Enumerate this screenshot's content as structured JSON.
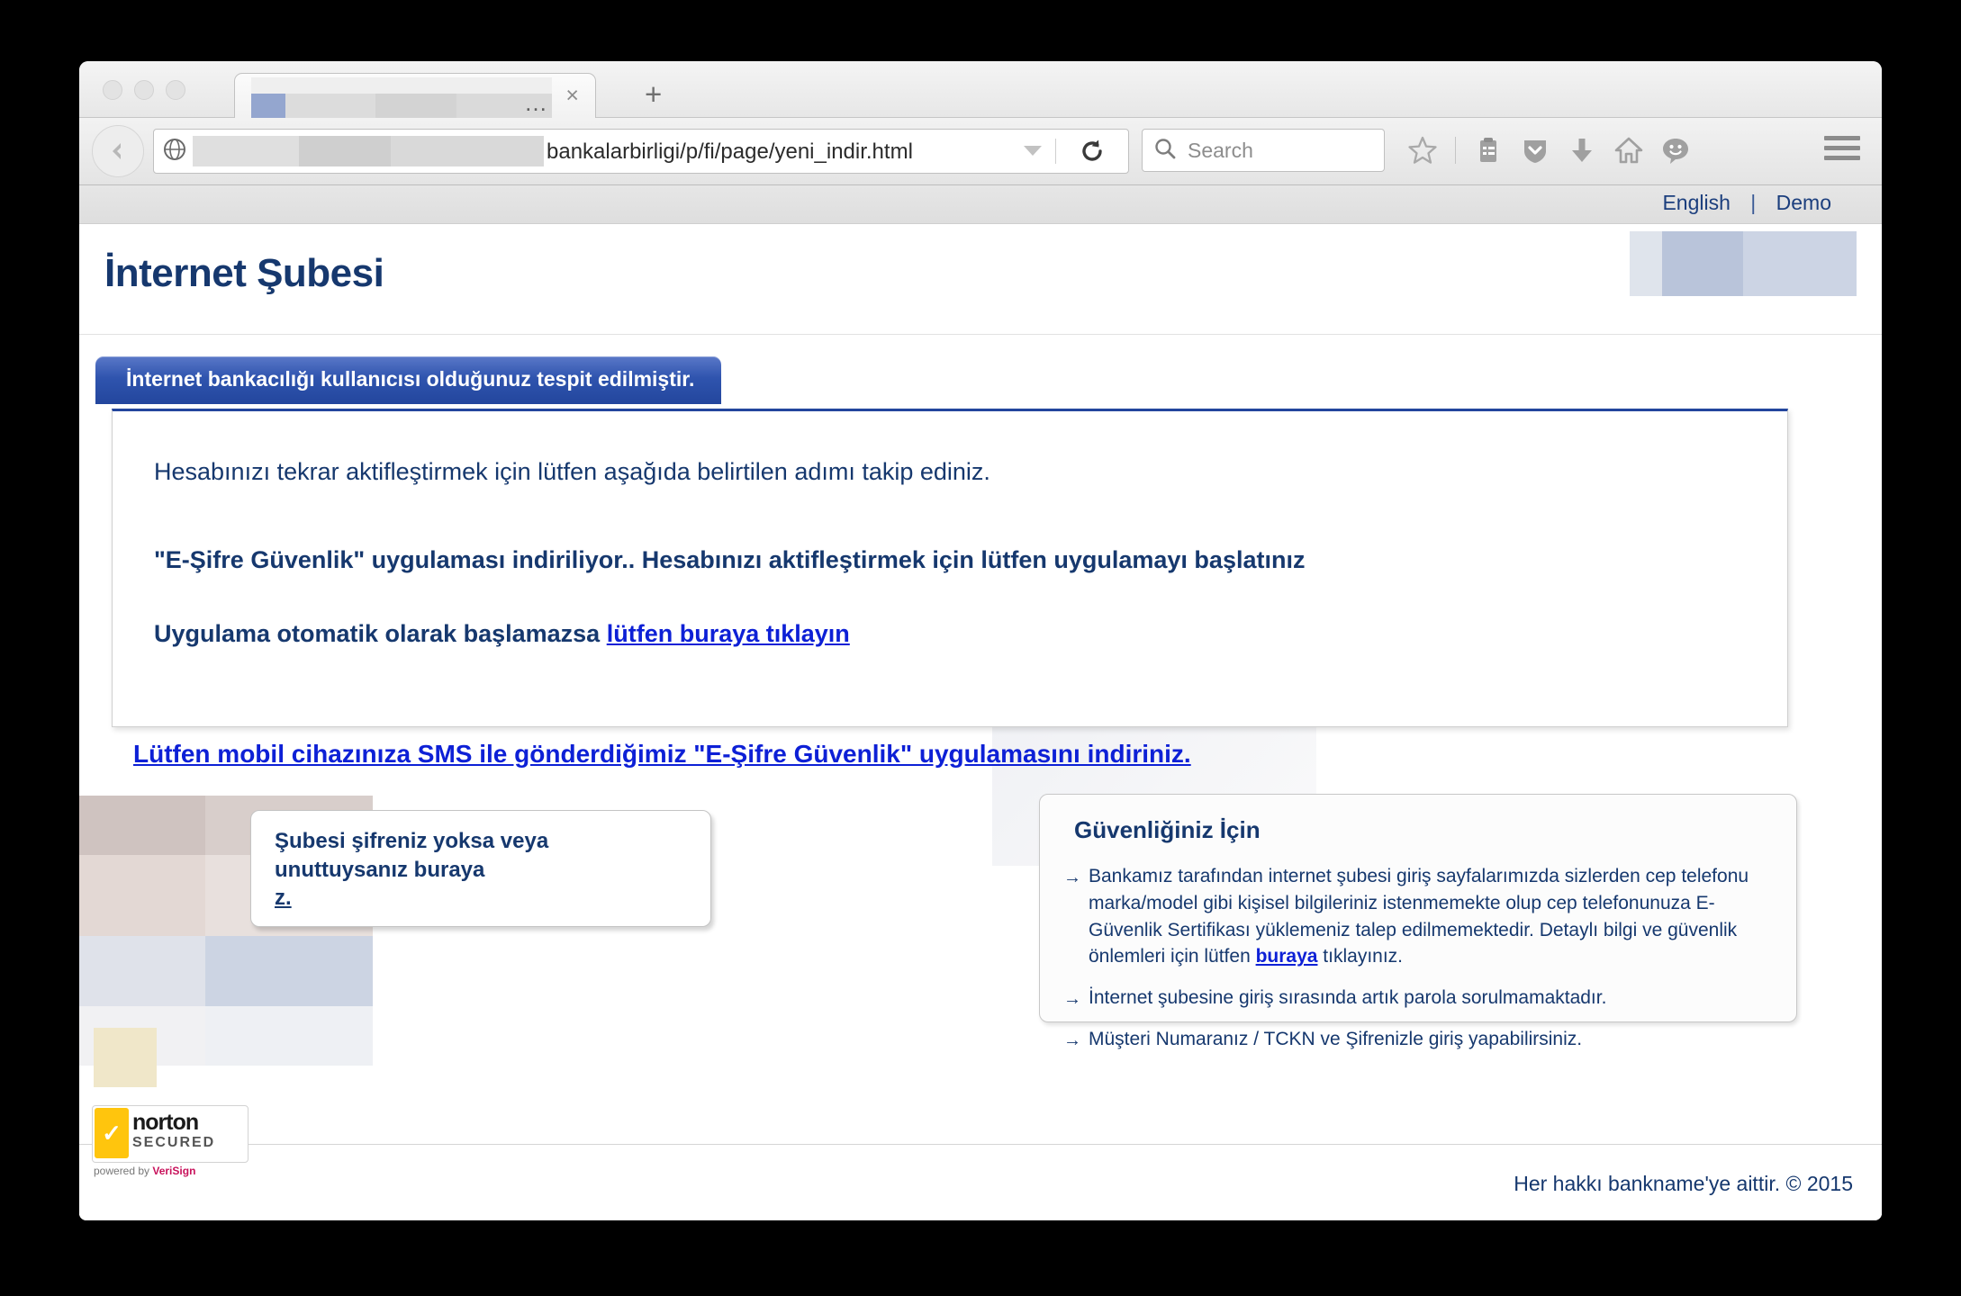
{
  "browser": {
    "tab": {
      "title_redacted": true,
      "ellipsis": "…",
      "close_label": "×"
    },
    "newtab_label": "+",
    "url": {
      "visible_text": "bankalarbirligi/p/fi/page/yeni_indir.html",
      "redacted_prefix": true
    },
    "search": {
      "placeholder": "Search",
      "icon": "search-icon"
    },
    "toolbar_icons": [
      "bookmark-star-icon",
      "reading-list-icon",
      "pocket-shield-icon",
      "download-arrow-icon",
      "home-icon",
      "smiley-feedback-icon",
      "hamburger-menu-icon"
    ]
  },
  "page": {
    "lang": {
      "english": "English",
      "separator": "|",
      "demo": "Demo"
    },
    "site_title": "İnternet Şubesi",
    "notice_banner": "İnternet bankacılığı kullanıcısı olduğunuz tespit edilmiştir.",
    "intro_line": "Hesabınızı tekrar aktifleştirmek için lütfen aşağıda belirtilen adımı takip ediniz.",
    "download_line": "\"E-Şifre Güvenlik\" uygulaması indiriliyor.. Hesabınızı aktifleştirmek için lütfen uygulamayı başlatınız",
    "auto_line_prefix": "Uygulama otomatik olarak başlamazsa ",
    "auto_line_link": "lütfen buraya tıklayın",
    "sms_line": "Lütfen mobil cihazınıza SMS ile gönderdiğimiz \"E-Şifre Güvenlik\" uygulamasını indiriniz.",
    "callout_left": {
      "line1": "Şubesi şifreniz yoksa veya",
      "line2": "unuttuysanız buraya",
      "line3": "z."
    },
    "infobox": {
      "title": "Güvenliğiniz İçin",
      "bullet_marker": "→",
      "items": [
        {
          "text_before": "Bankamız tarafından internet şubesi giriş sayfalarımızda sizlerden cep telefonu marka/model gibi kişisel bilgileriniz istenmemekte olup cep telefonunuza E-Güvenlik Sertifikası yüklemeniz talep edilmemektedir. Detaylı bilgi ve güvenlik önlemleri için lütfen ",
          "link": "buraya",
          "text_after": " tıklayınız."
        },
        {
          "text_before": "İnternet şubesine giriş sırasında artık parola sorulmamaktadır.",
          "link": "",
          "text_after": ""
        },
        {
          "text_before": "Müşteri Numaranız / TCKN ve Şifrenizle giriş yapabilirsiniz.",
          "link": "",
          "text_after": ""
        }
      ]
    },
    "footer": {
      "copyright": "Her hakkı bankname'ye aittir. © 2015",
      "norton": {
        "word": "norton",
        "sub": "SECURED",
        "powered": "powered by ",
        "powered_brand": "VeriSign"
      }
    }
  },
  "colors": {
    "brand_navy": "#16386e",
    "banner_blue": "#23469d",
    "link_blue": "#0d20d6",
    "norton_yellow": "#ffc50d"
  }
}
